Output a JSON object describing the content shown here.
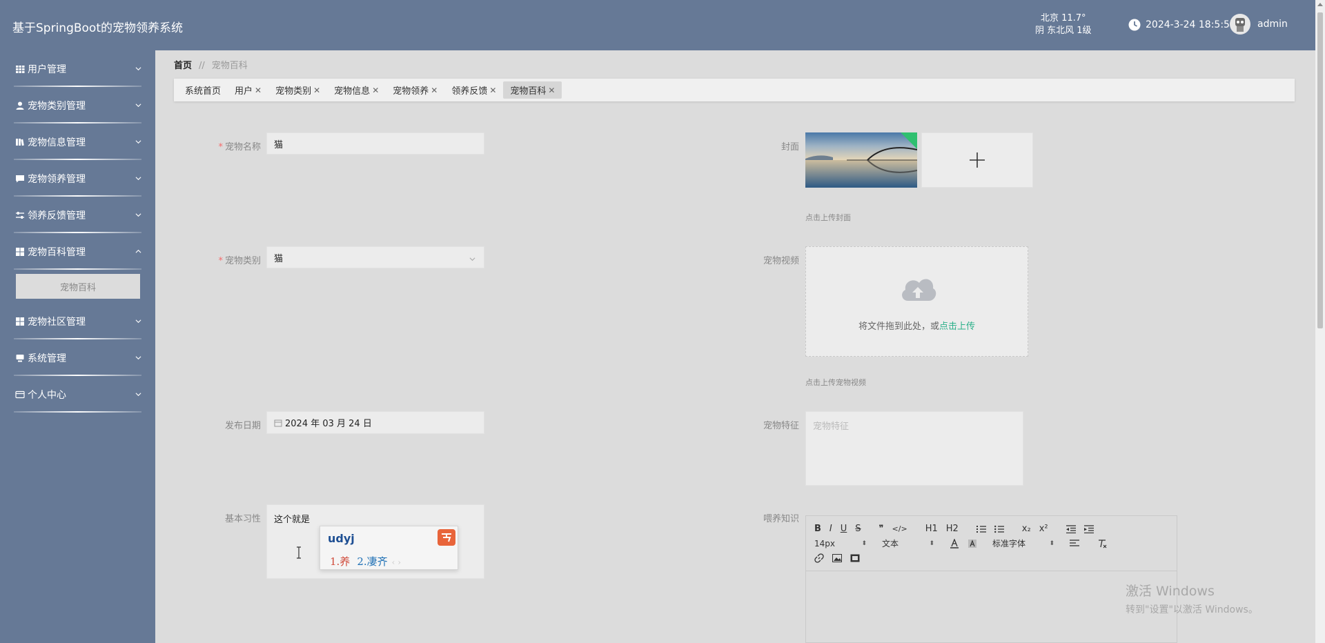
{
  "header": {
    "app_title": "基于SpringBoot的宠物领养系统",
    "weather_line1": "北京 11.7°",
    "weather_line2": "阴 东北风 1级",
    "datetime": "2024-3-24 18:5:59",
    "username": "admin"
  },
  "sidebar": {
    "items": [
      {
        "label": "用户管理",
        "icon": "grid-icon"
      },
      {
        "label": "宠物类别管理",
        "icon": "person-icon"
      },
      {
        "label": "宠物信息管理",
        "icon": "book-icon"
      },
      {
        "label": "宠物领养管理",
        "icon": "chat-icon"
      },
      {
        "label": "领养反馈管理",
        "icon": "sliders-icon"
      },
      {
        "label": "宠物百科管理",
        "icon": "apps-icon",
        "expanded": true,
        "sub": [
          "宠物百科"
        ]
      },
      {
        "label": "宠物社区管理",
        "icon": "apps-icon"
      },
      {
        "label": "系统管理",
        "icon": "monitor-icon"
      },
      {
        "label": "个人中心",
        "icon": "card-icon"
      }
    ]
  },
  "breadcrumb": {
    "home": "首页",
    "separator": "//",
    "current": "宠物百科"
  },
  "tags": [
    {
      "label": "系统首页",
      "closable": false
    },
    {
      "label": "用户",
      "closable": true
    },
    {
      "label": "宠物类别",
      "closable": true
    },
    {
      "label": "宠物信息",
      "closable": true
    },
    {
      "label": "宠物领养",
      "closable": true
    },
    {
      "label": "领养反馈",
      "closable": true
    },
    {
      "label": "宠物百科",
      "closable": true,
      "active": true
    }
  ],
  "form": {
    "name_label": "宠物名称",
    "name_value": "猫",
    "cover_label": "封面",
    "cover_hint": "点击上传封面",
    "category_label": "宠物类别",
    "category_value": "猫",
    "video_label": "宠物视频",
    "video_upload_text": "将文件拖到此处，或",
    "video_upload_link": "点击上传",
    "video_hint": "点击上传宠物视频",
    "date_label": "发布日期",
    "date_value": "2024 年 03 月 24 日",
    "feature_label": "宠物特征",
    "feature_placeholder": "宠物特征",
    "habit_label": "基本习性",
    "habit_value": "这个就是",
    "feeding_label": "喂养知识"
  },
  "ime": {
    "code": "udyj",
    "cand1": "1.养",
    "cand2": "2.凄齐",
    "nav": "‹ ›"
  },
  "editor": {
    "size_value": "14px",
    "format_value": "文本",
    "font_value": "标准字体",
    "buttons": [
      "B",
      "I",
      "U",
      "S",
      "❞",
      "</>",
      "H1",
      "H2",
      "ordered-list",
      "bullet-list",
      "x₂",
      "x²",
      "outdent",
      "indent"
    ]
  },
  "watermark": {
    "line1": "激活 Windows",
    "line2": "转到\"设置\"以激活 Windows。"
  },
  "colors": {
    "sidebar_bg": "#667996",
    "page_bg": "#dcdcdc",
    "link": "#2bb08a",
    "required": "#f56c6c"
  }
}
